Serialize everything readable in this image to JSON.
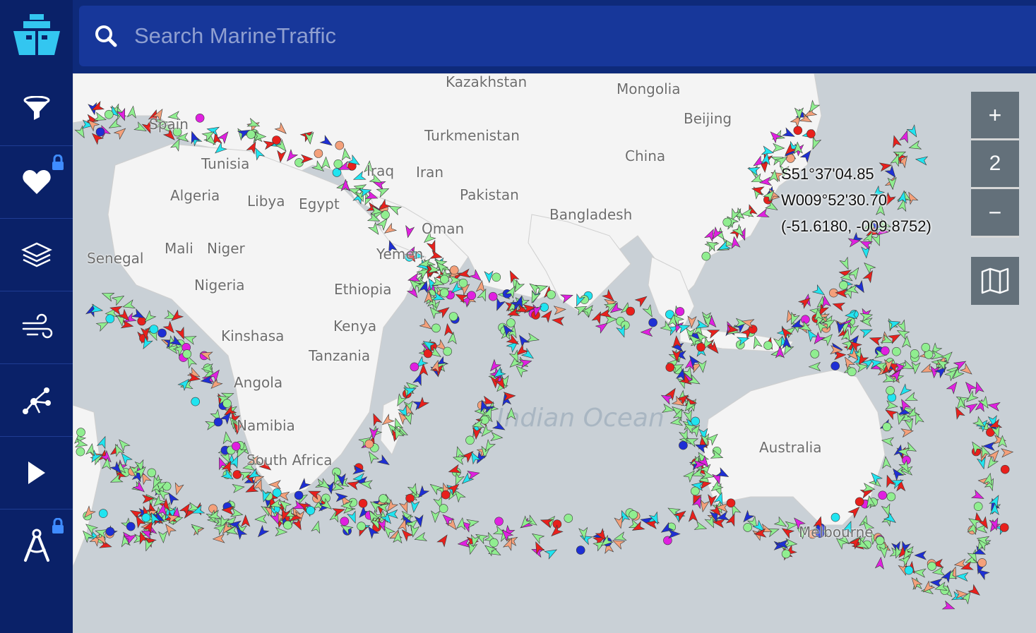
{
  "search": {
    "placeholder": "Search MarineTraffic"
  },
  "sidebar": {
    "items": [
      {
        "name": "filters",
        "icon": "filter-icon",
        "locked": false
      },
      {
        "name": "favorites",
        "icon": "heart-icon",
        "locked": true
      },
      {
        "name": "layers",
        "icon": "layers-icon",
        "locked": false
      },
      {
        "name": "weather",
        "icon": "wind-icon",
        "locked": false
      },
      {
        "name": "routes",
        "icon": "network-icon",
        "locked": false
      },
      {
        "name": "playback",
        "icon": "play-icon",
        "locked": false
      },
      {
        "name": "measure",
        "icon": "compass-icon",
        "locked": true
      }
    ]
  },
  "map": {
    "countries": [
      "Kazakhstan",
      "Mongolia",
      "Beijing",
      "China",
      "Spain",
      "Tunisia",
      "Iraq",
      "Iran",
      "Turkmenistan",
      "Algeria",
      "Libya",
      "Egypt",
      "Pakistan",
      "Bangladesh",
      "Oman",
      "Yemen",
      "Mali",
      "Niger",
      "Senegal",
      "Nigeria",
      "Ethiopia",
      "Kenya",
      "Kinshasa",
      "Tanzania",
      "Angola",
      "Namibia",
      "South Africa",
      "Australia",
      "Melbourne"
    ],
    "ocean_label": "Indian Ocean",
    "colors": {
      "land": "#f4f4f4",
      "ocean": "#c9d0d6",
      "cargo": "#90ee90",
      "tanker": "#e8201c",
      "passenger": "#1e2fd4",
      "fishing": "#f4a07a",
      "tug": "#20e4f0",
      "pleasure": "#e020e0"
    }
  },
  "zoom": {
    "in_label": "+",
    "level": "2",
    "out_label": "−"
  },
  "cursor_coords": {
    "lat": "S51°37'04.85",
    "lon": "W009°52'30.70",
    "decimal": "(-51.6180, -009.8752)"
  }
}
